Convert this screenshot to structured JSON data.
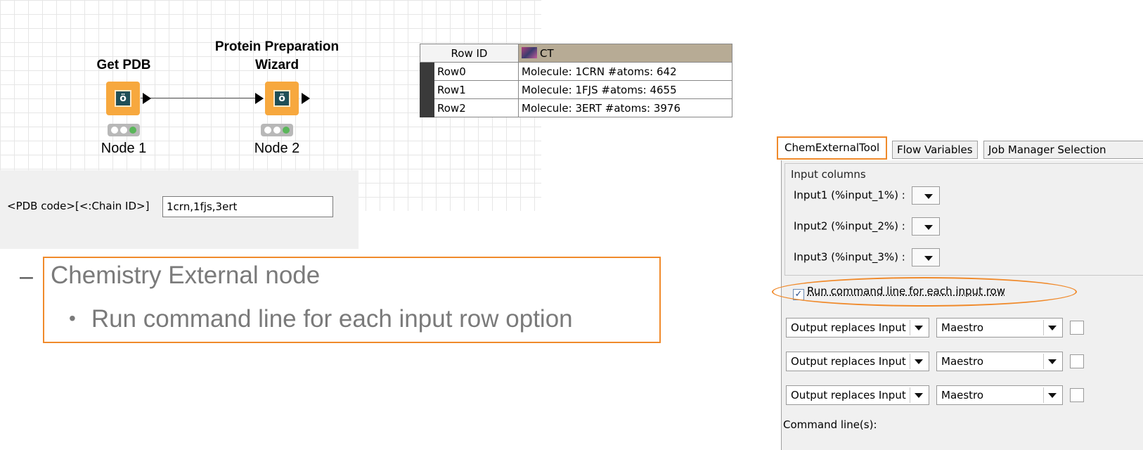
{
  "workflow": {
    "node1": {
      "title": "Get PDB",
      "label": "Node 1"
    },
    "node2": {
      "title": "Protein Preparation\nWizard",
      "label": "Node 2"
    }
  },
  "pdb_dialog": {
    "label": "<PDB code>[<:Chain ID>]",
    "value": "1crn,1fjs,3ert"
  },
  "table": {
    "headers": {
      "row_id": "Row ID",
      "ct": "CT"
    },
    "rows": [
      {
        "id": "Row0",
        "value": "Molecule: 1CRN #atoms: 642"
      },
      {
        "id": "Row1",
        "value": "Molecule: 1FJS #atoms: 4655"
      },
      {
        "id": "Row2",
        "value": "Molecule: 3ERT #atoms: 3976"
      }
    ]
  },
  "bullets": {
    "dash": "–",
    "level1": "Chemistry External node",
    "level2_dot": "•",
    "level2": "Run command line for each input row option"
  },
  "dialog": {
    "tabs": [
      "ChemExternalTool",
      "Flow Variables",
      "Job Manager Selection"
    ],
    "group_title": "Input columns",
    "inputs": [
      "Input1 (%input_1%) :",
      "Input2 (%input_2%) :",
      "Input3 (%input_3%) :"
    ],
    "checkbox_label": "Run command line for each input row",
    "checkbox_checked": true,
    "output_rows": [
      {
        "mode": "Output replaces Input",
        "format": "Maestro"
      },
      {
        "mode": "Output replaces Input",
        "format": "Maestro"
      },
      {
        "mode": "Output replaces Input",
        "format": "Maestro"
      }
    ],
    "command_label": "Command line(s):"
  },
  "colors": {
    "highlight": "#f08a2b",
    "node_orange": "#f7a83e",
    "ct_header": "#b7ab95"
  }
}
